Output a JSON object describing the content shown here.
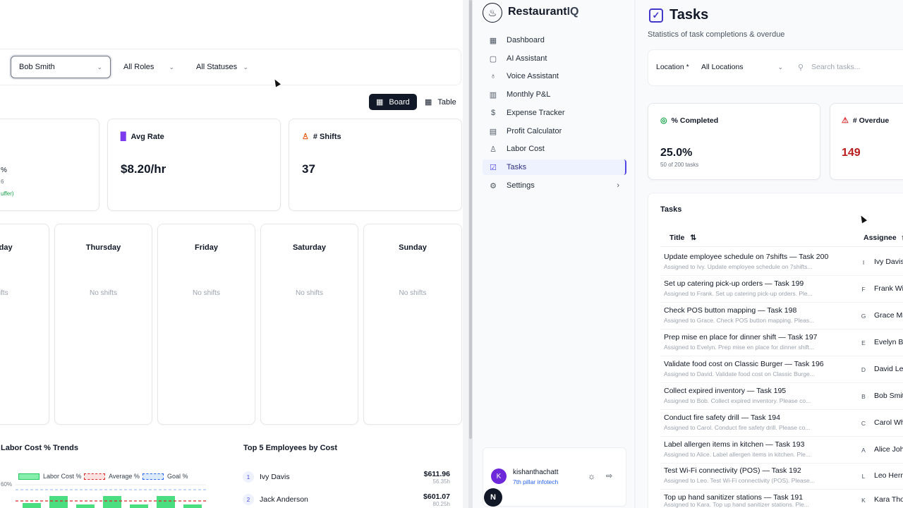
{
  "labor": {
    "filters": {
      "employee": "Bob Smith",
      "roles": "All Roles",
      "statuses": "All Statuses"
    },
    "view_toggle": {
      "board": "Board",
      "table": "Table"
    },
    "stat_partial": {
      "line1": "%",
      "line2": "6",
      "line3": "uffer)"
    },
    "avg_rate": {
      "label": "Avg Rate",
      "value": "$8.20/hr"
    },
    "shifts": {
      "label": "# Shifts",
      "value": "37"
    },
    "days": [
      {
        "name": "esday",
        "empty": "shifts"
      },
      {
        "name": "Thursday",
        "empty": "No shifts"
      },
      {
        "name": "Friday",
        "empty": "No shifts"
      },
      {
        "name": "Saturday",
        "empty": "No shifts"
      },
      {
        "name": "Sunday",
        "empty": "No shifts"
      }
    ],
    "trends": {
      "title": "Labor Cost % Trends",
      "legend": [
        "Labor Cost %",
        "Average %",
        "Goal %"
      ],
      "ytick": "60%",
      "colors": {
        "bar": "#4ade80",
        "average": "#dc2626",
        "goal": "#2563eb"
      }
    },
    "top_employees": {
      "title": "Top 5 Employees by Cost",
      "items": [
        {
          "rank": "1",
          "name": "Ivy Davis",
          "amount": "$611.96",
          "hours": "56.35h"
        },
        {
          "rank": "2",
          "name": "Jack Anderson",
          "amount": "$601.07",
          "hours": "80.25h"
        }
      ]
    }
  },
  "sidebar": {
    "brand": {
      "main": "Restaurant",
      "suffix": "IQ"
    },
    "items": [
      {
        "label": "Dashboard",
        "icon": "▦"
      },
      {
        "label": "AI Assistant",
        "icon": "▢"
      },
      {
        "label": "Voice Assistant",
        "icon": "♁"
      },
      {
        "label": "Monthly P&L",
        "icon": "▥"
      },
      {
        "label": "Expense Tracker",
        "icon": "$"
      },
      {
        "label": "Profit Calculator",
        "icon": "▤"
      },
      {
        "label": "Labor Cost",
        "icon": "♙"
      },
      {
        "label": "Tasks",
        "icon": "☑"
      },
      {
        "label": "Settings",
        "icon": "⚙",
        "chevron": "›"
      }
    ],
    "user": {
      "initial": "K",
      "name": "kishanthachatt",
      "org": "7th pillar infotech",
      "badge": "N"
    }
  },
  "tasks": {
    "title": "Tasks",
    "subtitle": "Statistics of task completions & overdue",
    "location_label": "Location *",
    "location_value": "All Locations",
    "search_placeholder": "Search tasks...",
    "completed": {
      "label": "% Completed",
      "value": "25.0%",
      "detail": "50 of 200 tasks"
    },
    "overdue": {
      "label": "# Overdue",
      "value": "149"
    },
    "list_title": "Tasks",
    "columns": {
      "title": "Title",
      "assignee": "Assignee"
    },
    "rows": [
      {
        "title": "Update employee schedule on 7shifts — Task 200",
        "sub": "Assigned to Ivy. Update employee schedule on 7shifts...",
        "initial": "I",
        "assignee": "Ivy Davis"
      },
      {
        "title": "Set up catering pick-up orders — Task 199",
        "sub": "Assigned to Frank. Set up catering pick-up orders. Ple...",
        "initial": "F",
        "assignee": "Frank Wi"
      },
      {
        "title": "Check POS button mapping — Task 198",
        "sub": "Assigned to Grace. Check POS button mapping. Pleas...",
        "initial": "G",
        "assignee": "Grace Ma"
      },
      {
        "title": "Prep mise en place for dinner shift — Task 197",
        "sub": "Assigned to Evelyn. Prep mise en place for dinner shift...",
        "initial": "E",
        "assignee": "Evelyn Br"
      },
      {
        "title": "Validate food cost on Classic Burger — Task 196",
        "sub": "Assigned to David. Validate food cost on Classic Burge...",
        "initial": "D",
        "assignee": "David Le"
      },
      {
        "title": "Collect expired inventory — Task 195",
        "sub": "Assigned to Bob. Collect expired inventory. Please co...",
        "initial": "B",
        "assignee": "Bob Smit"
      },
      {
        "title": "Conduct fire safety drill — Task 194",
        "sub": "Assigned to Carol. Conduct fire safety drill. Please co...",
        "initial": "C",
        "assignee": "Carol Wh"
      },
      {
        "title": "Label allergen items in kitchen — Task 193",
        "sub": "Assigned to Alice. Label allergen items in kitchen. Ple...",
        "initial": "A",
        "assignee": "Alice Joh"
      },
      {
        "title": "Test Wi-Fi connectivity (POS) — Task 192",
        "sub": "Assigned to Leo. Test Wi-Fi connectivity (POS). Please...",
        "initial": "L",
        "assignee": "Leo Hern"
      },
      {
        "title": "Top up hand sanitizer stations — Task 191",
        "sub": "Assigned to Kara. Top up hand sanitizer stations. Ple...",
        "initial": "K",
        "assignee": "Kara Tho"
      }
    ]
  }
}
